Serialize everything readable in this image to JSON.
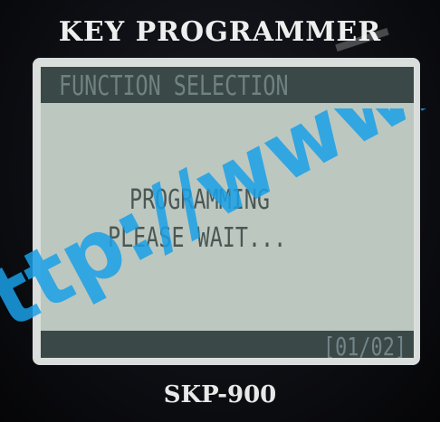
{
  "device": {
    "brand_title": "KEY PROGRAMMER",
    "model": "SKP-900"
  },
  "screen": {
    "header": "FUNCTION SELECTION",
    "message_line1": "PROGRAMMING",
    "message_line2": "PLEASE WAIT...",
    "page_indicator": "[01/02]"
  },
  "watermark": {
    "text": "ttp://www.c",
    "color": "#1aa0e6"
  },
  "colors": {
    "lcd_background": "#bcc7bf",
    "lcd_bar": "#3a4948",
    "lcd_text": "#4b5755"
  }
}
